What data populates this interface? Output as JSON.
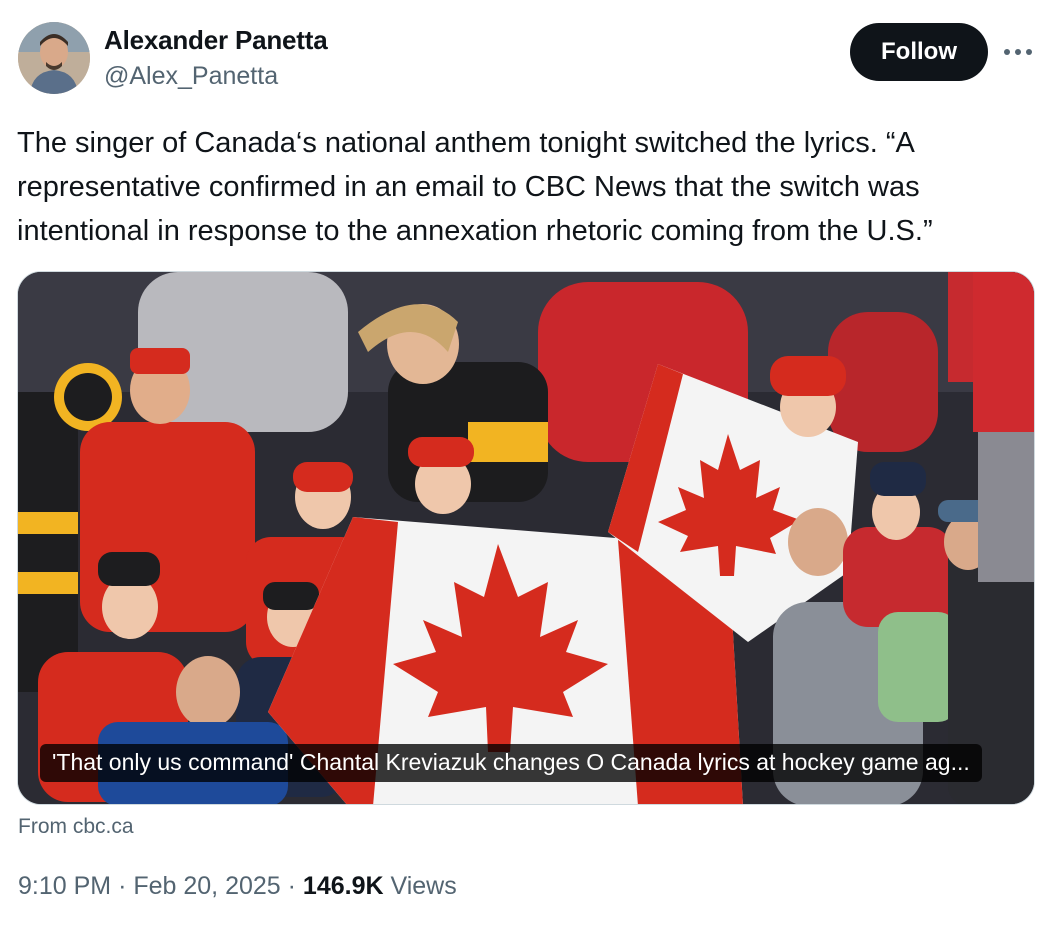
{
  "author": {
    "name": "Alexander Panetta",
    "handle": "@Alex_Panetta"
  },
  "actions": {
    "follow_label": "Follow",
    "more_icon": "more-horizontal-icon"
  },
  "tweet": {
    "text": "The singer of Canada‘s national anthem tonight switched the lyrics. “A representative confirmed in an email to CBC News that the switch was intentional in response to the annexation rhetoric coming from the U.S.”"
  },
  "card": {
    "caption": "'That only us command' Chantal Kreviazuk changes O Canada lyrics at hockey game ag...",
    "source": "From cbc.ca"
  },
  "meta": {
    "time": "9:10 PM",
    "separator": "·",
    "date": "Feb 20, 2025",
    "views_count": "146.9K",
    "views_label": "Views"
  },
  "colors": {
    "text": "#0f1419",
    "secondary": "#536471",
    "follow_bg": "#0f1419",
    "flag_red": "#d52b1e"
  }
}
